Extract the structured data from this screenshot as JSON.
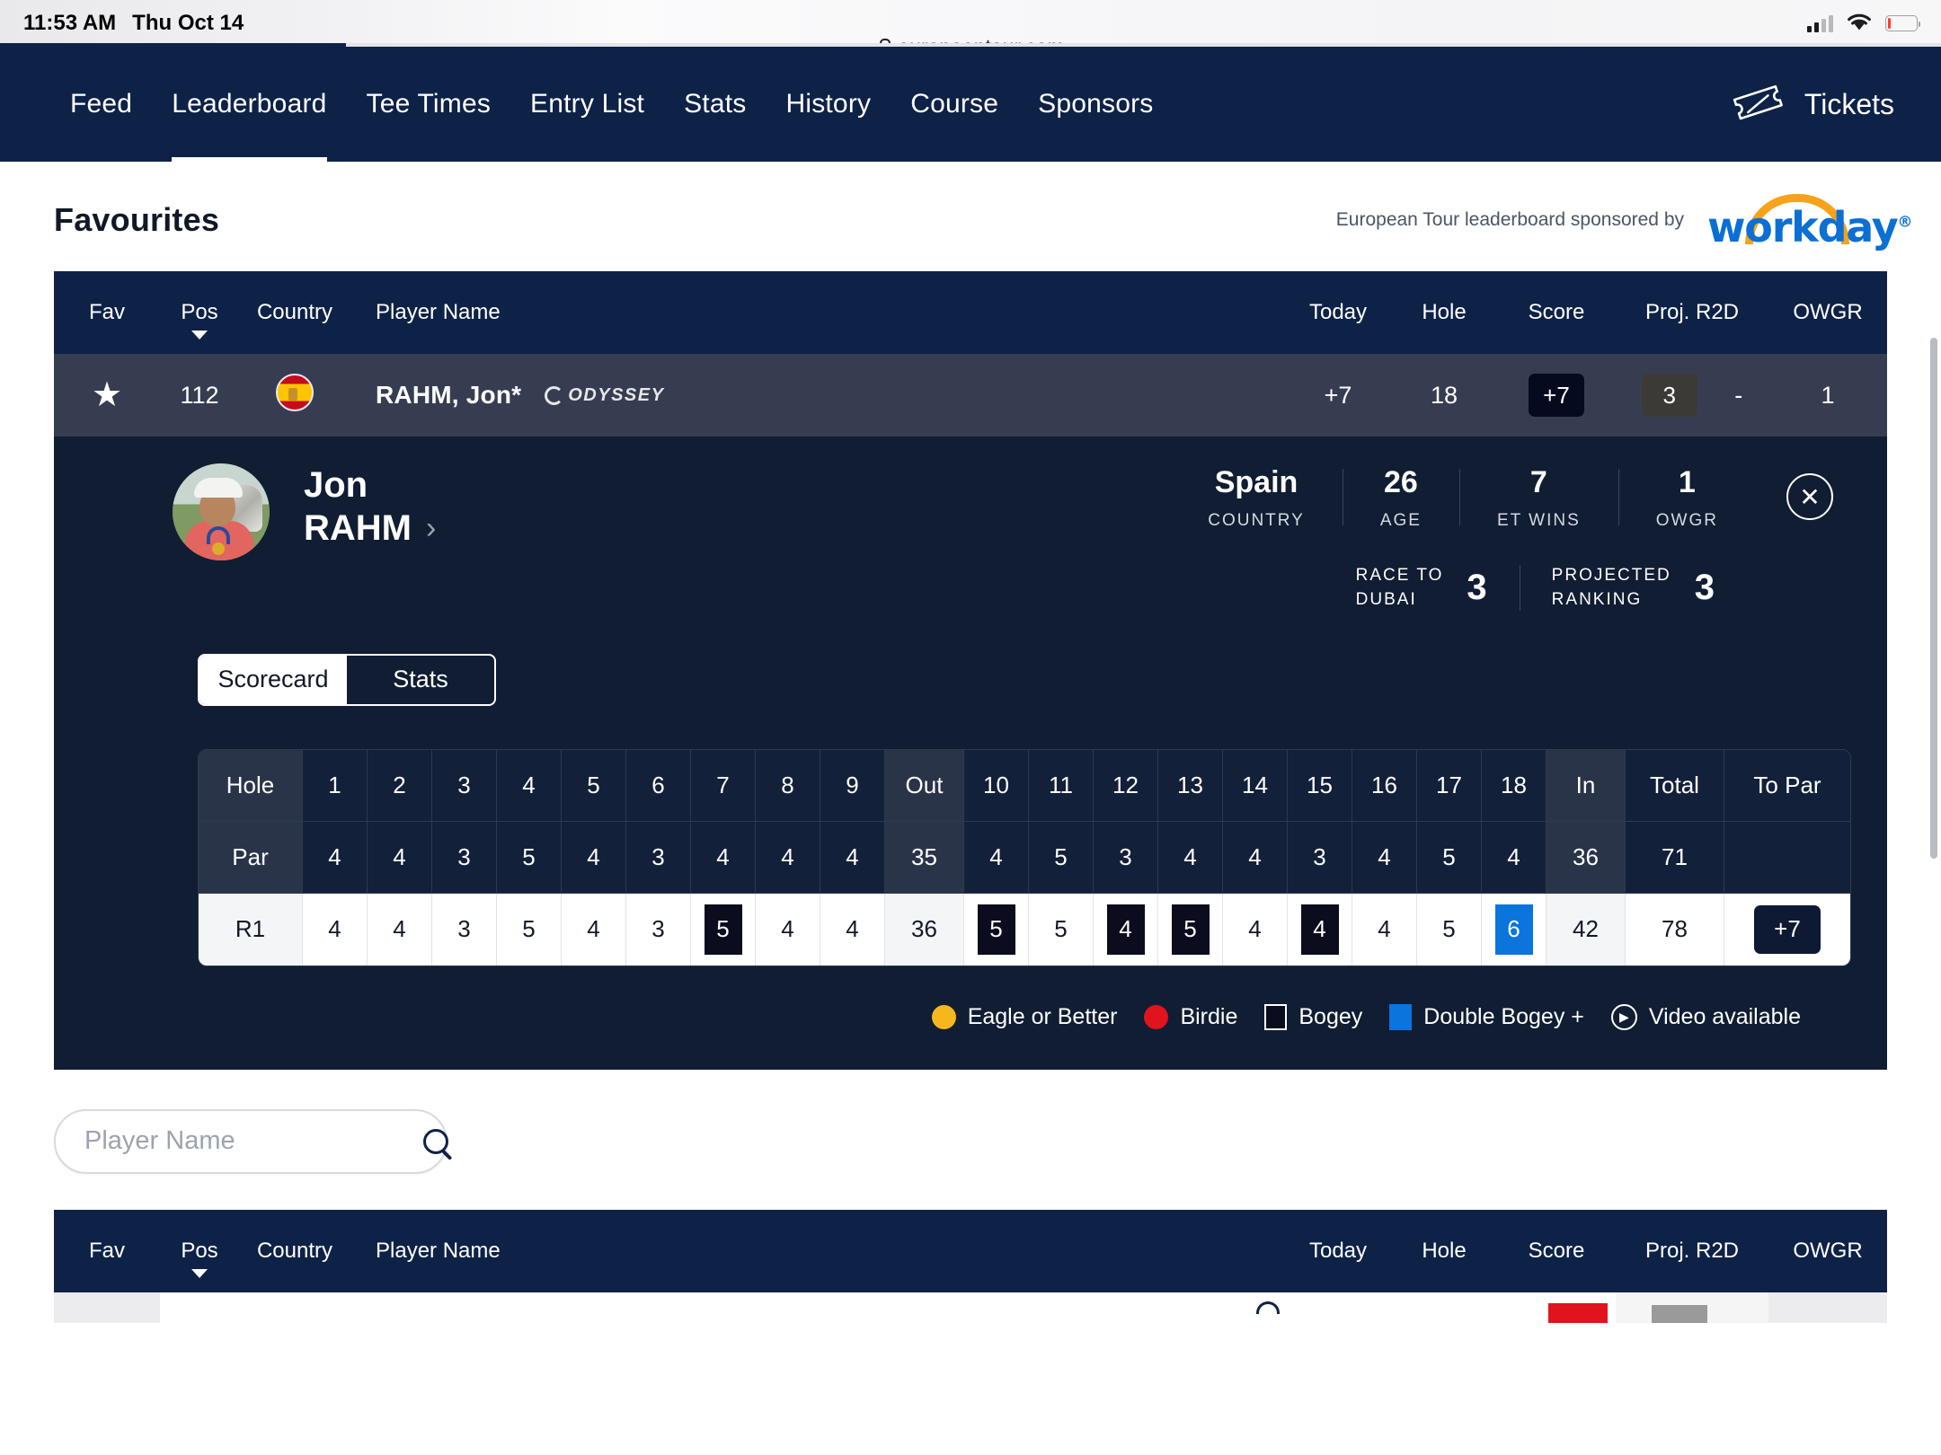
{
  "status_bar": {
    "time": "11:53 AM",
    "date": "Thu Oct 14",
    "signal_icon": "cellular-signal-icon",
    "wifi_icon": "wifi-icon",
    "battery_icon": "battery-icon"
  },
  "browser": {
    "url": "europeantour.com",
    "lock_icon": "lock-icon"
  },
  "nav": {
    "items": [
      {
        "label": "Feed",
        "active": false
      },
      {
        "label": "Leaderboard",
        "active": true
      },
      {
        "label": "Tee Times",
        "active": false
      },
      {
        "label": "Entry List",
        "active": false
      },
      {
        "label": "Stats",
        "active": false
      },
      {
        "label": "History",
        "active": false
      },
      {
        "label": "Course",
        "active": false
      },
      {
        "label": "Sponsors",
        "active": false
      }
    ],
    "tickets_label": "Tickets",
    "tickets_icon": "ticket-icon"
  },
  "section": {
    "title": "Favourites",
    "sponsor_text": "European Tour leaderboard sponsored by",
    "sponsor_logo": "workday",
    "sponsor_reg": "®"
  },
  "leaderboard": {
    "columns": {
      "fav": "Fav",
      "pos": "Pos",
      "country": "Country",
      "player_name": "Player Name",
      "today": "Today",
      "hole": "Hole",
      "score": "Score",
      "proj_r2d": "Proj. R2D",
      "owgr": "OWGR"
    },
    "sort_caret_icon": "chevron-down-icon",
    "row": {
      "fav_icon": "star-filled-icon",
      "pos": "112",
      "country_icon": "spain-flag-icon",
      "player_name": "RAHM, Jon*",
      "sponsor_brand": "ODYSSEY",
      "today": "+7",
      "hole": "18",
      "score": "+7",
      "proj_r2d": "3",
      "owgr_dash": "-",
      "owgr": "1"
    }
  },
  "player_detail": {
    "avatar_icon": "player-photo-avatar",
    "first_name": "Jon",
    "last_name": "RAHM",
    "chevron_icon": "chevron-right-icon",
    "close_icon": "close-icon",
    "stats": [
      {
        "value": "Spain",
        "label": "COUNTRY"
      },
      {
        "value": "26",
        "label": "AGE"
      },
      {
        "value": "7",
        "label": "ET WINS"
      },
      {
        "value": "1",
        "label": "OWGR"
      }
    ],
    "rankings": [
      {
        "label_line1": "RACE TO",
        "label_line2": "DUBAI",
        "value": "3"
      },
      {
        "label_line1": "PROJECTED",
        "label_line2": "RANKING",
        "value": "3"
      }
    ],
    "toggle": {
      "scorecard": "Scorecard",
      "stats": "Stats",
      "active": "Scorecard"
    }
  },
  "scorecard": {
    "row_labels": {
      "hole": "Hole",
      "par": "Par",
      "round": "R1"
    },
    "hole_numbers": [
      "1",
      "2",
      "3",
      "4",
      "5",
      "6",
      "7",
      "8",
      "9"
    ],
    "hole_numbers_back": [
      "10",
      "11",
      "12",
      "13",
      "14",
      "15",
      "16",
      "17",
      "18"
    ],
    "out_label": "Out",
    "in_label": "In",
    "total_label": "Total",
    "to_par_label": "To Par",
    "par_front": [
      "4",
      "4",
      "3",
      "5",
      "4",
      "3",
      "4",
      "4",
      "4"
    ],
    "par_out": "35",
    "par_back": [
      "4",
      "5",
      "3",
      "4",
      "4",
      "3",
      "4",
      "5",
      "4"
    ],
    "par_in": "36",
    "par_total": "71",
    "par_to_par": "",
    "r1_front": [
      "4",
      "4",
      "3",
      "5",
      "4",
      "3",
      "5",
      "4",
      "4"
    ],
    "r1_front_marks": [
      "",
      "",
      "",
      "",
      "",
      "",
      "bogey",
      "",
      ""
    ],
    "r1_out": "36",
    "r1_back": [
      "5",
      "5",
      "4",
      "5",
      "4",
      "4",
      "4",
      "5",
      "6"
    ],
    "r1_back_marks": [
      "bogey",
      "",
      "bogey",
      "bogey",
      "",
      "bogey",
      "",
      "",
      "double"
    ],
    "r1_in": "42",
    "r1_total": "78",
    "r1_to_par": "+7"
  },
  "legend": [
    {
      "label": "Eagle or Better",
      "shape": "circle",
      "color": "#f5b81c",
      "icon": "eagle-marker-icon"
    },
    {
      "label": "Birdie",
      "shape": "circle",
      "color": "#e1131d",
      "icon": "birdie-marker-icon"
    },
    {
      "label": "Bogey",
      "shape": "square",
      "color": "#0b0d1e",
      "icon": "bogey-marker-icon"
    },
    {
      "label": "Double Bogey +",
      "shape": "square",
      "color": "#0b74dd",
      "icon": "double-bogey-marker-icon"
    },
    {
      "label": "Video available",
      "shape": "play",
      "color": "#ffffff",
      "icon": "play-circle-icon"
    }
  ],
  "search": {
    "placeholder": "Player Name",
    "value": "",
    "icon": "search-icon"
  },
  "colors": {
    "navy": "#0e2247",
    "panel_navy": "#101d33",
    "row_slate": "#373d51",
    "accent_blue": "#0b74dd",
    "sponsor_orange": "#f5a31a",
    "sponsor_blue": "#0b6fd4"
  }
}
